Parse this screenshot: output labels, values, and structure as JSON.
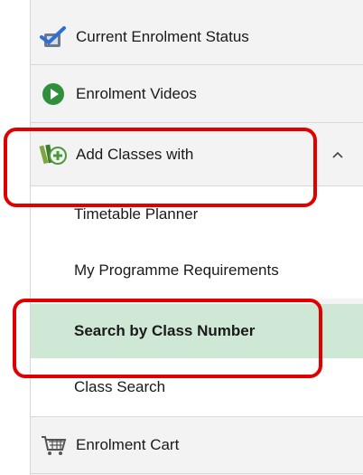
{
  "menu": {
    "items": [
      {
        "label": "Current Enrolment Status",
        "icon": "check-clipboard-icon"
      },
      {
        "label": "Enrolment Videos",
        "icon": "play-circle-icon"
      },
      {
        "label": "Add Classes with",
        "icon": "add-classes-icon",
        "expanded": true
      }
    ],
    "subitems": [
      {
        "label": "Timetable Planner"
      },
      {
        "label": "My Programme Requirements"
      },
      {
        "label": "Search by Class Number",
        "active": true
      },
      {
        "label": "Class Search"
      }
    ],
    "cart": {
      "label": "Enrolment Cart",
      "icon": "shopping-cart-icon"
    }
  },
  "colors": {
    "highlight": "#e00000",
    "active_bg": "#cfe8d6",
    "play_green": "#2f8f3a"
  }
}
